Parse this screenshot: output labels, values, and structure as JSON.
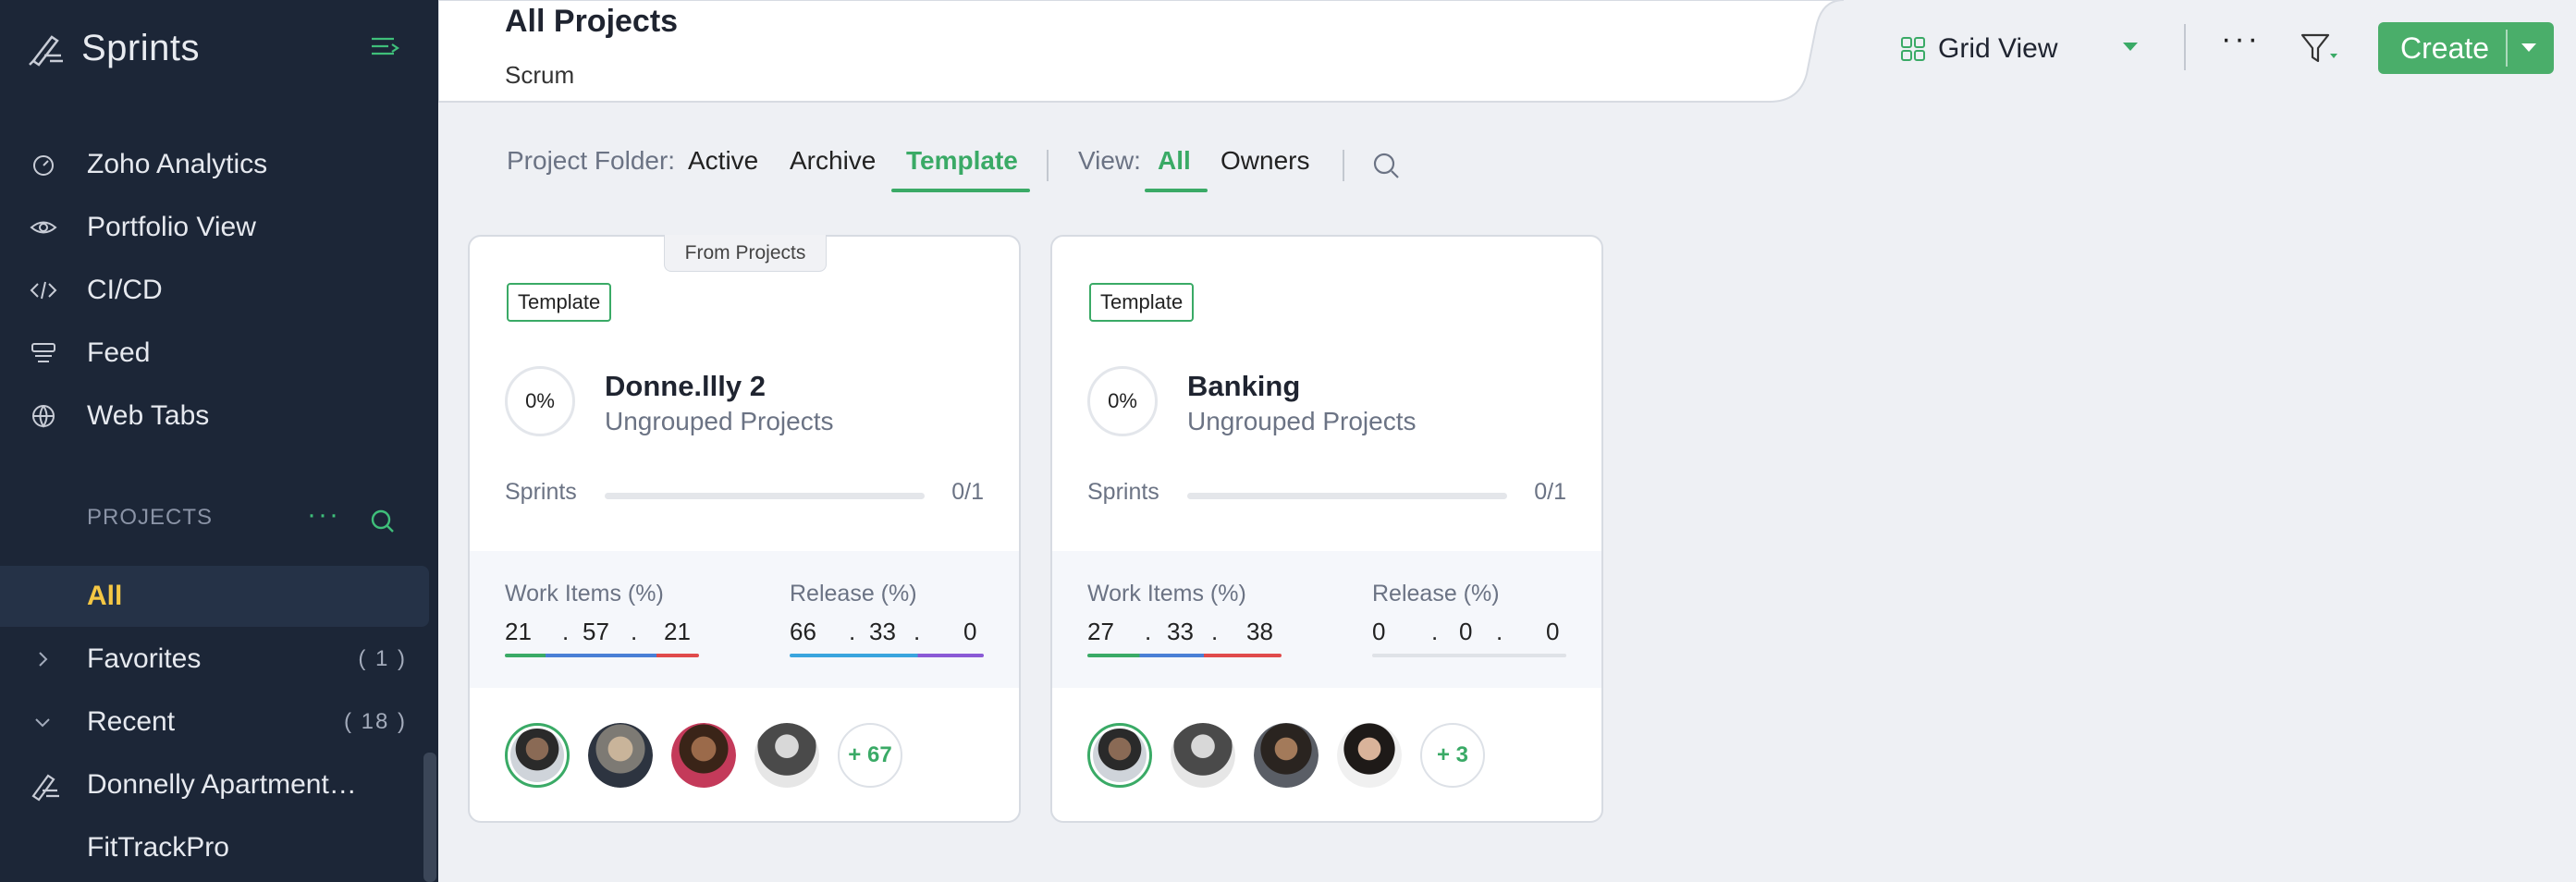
{
  "sidebar": {
    "app_name": "Sprints",
    "nav": [
      {
        "label": "Zoho Analytics",
        "icon": "analytics-gauge-icon"
      },
      {
        "label": "Portfolio View",
        "icon": "eye-icon"
      },
      {
        "label": "CI/CD",
        "icon": "code-icon"
      },
      {
        "label": "Feed",
        "icon": "feed-icon"
      },
      {
        "label": "Web Tabs",
        "icon": "globe-icon"
      }
    ],
    "projects_section_title": "PROJECTS",
    "project_items": [
      {
        "label": "All"
      },
      {
        "label": "Favorites",
        "count": "( 1 )"
      },
      {
        "label": "Recent",
        "count": "( 18 )"
      },
      {
        "label": "Donnelly Apartment…"
      },
      {
        "label": "FitTrackPro"
      }
    ]
  },
  "header": {
    "title": "All Projects",
    "subtitle": "Scrum",
    "view_label": "Grid View",
    "create_label": "Create"
  },
  "filter_bar": {
    "folder_label": "Project Folder:",
    "folders": [
      "Active",
      "Archive",
      "Template"
    ],
    "active_folder": "Template",
    "view_label": "View:",
    "views": [
      "All",
      "Owners"
    ],
    "active_view": "All"
  },
  "cards": [
    {
      "from_tag": "From Projects",
      "badge": "Template",
      "percent": "0%",
      "name": "Donne.llly 2",
      "group": "Ungrouped Projects",
      "sprints_label": "Sprints",
      "sprints_value": "0/1",
      "work_items_label": "Work Items (%)",
      "work_items": [
        "21",
        "57",
        "21"
      ],
      "release_label": "Release (%)",
      "release": [
        "66",
        "33",
        "0"
      ],
      "more_members": "+ 67"
    },
    {
      "badge": "Template",
      "percent": "0%",
      "name": "Banking",
      "group": "Ungrouped Projects",
      "sprints_label": "Sprints",
      "sprints_value": "0/1",
      "work_items_label": "Work Items (%)",
      "work_items": [
        "27",
        "33",
        "38"
      ],
      "release_label": "Release (%)",
      "release": [
        "0",
        "0",
        "0"
      ],
      "more_members": "+ 3"
    }
  ],
  "colors": {
    "sidebar_bg": "#1c2637",
    "accent_green": "#3aaa66",
    "active_project": "#f5c744",
    "create_button": "#4aae6a"
  }
}
